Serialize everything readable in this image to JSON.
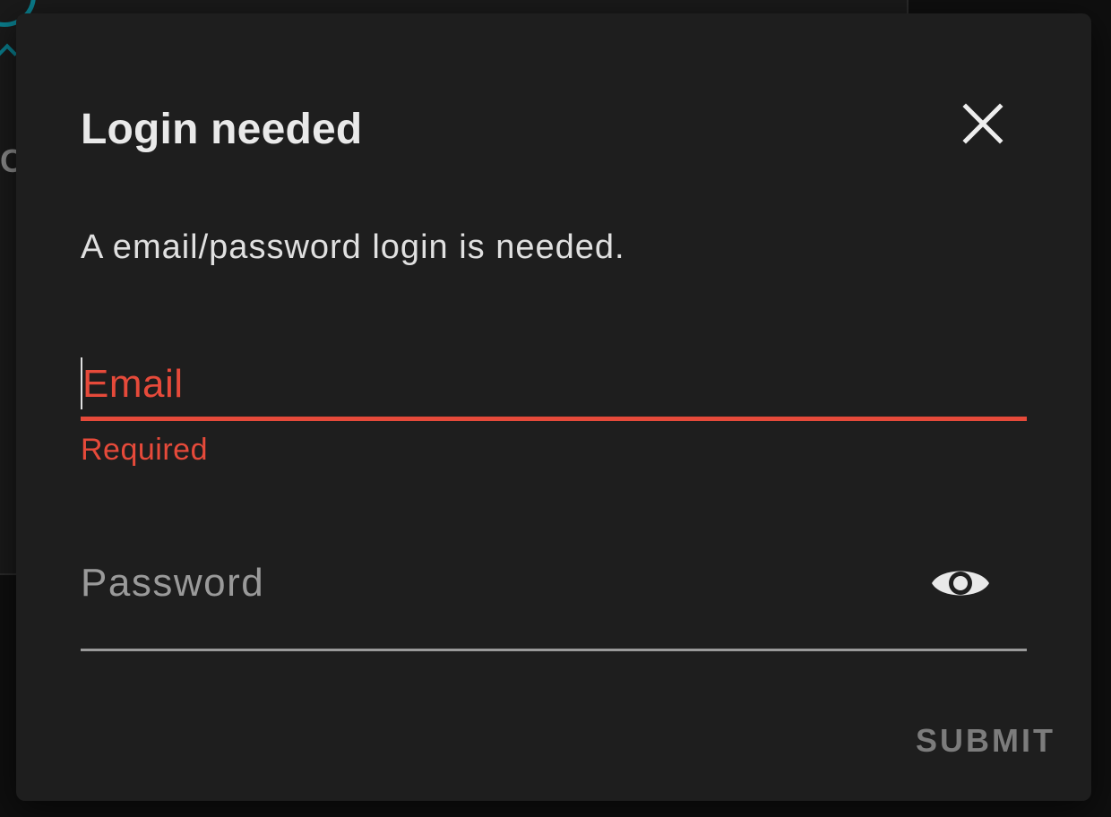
{
  "dialog": {
    "title": "Login needed",
    "description": "A email/password login is needed.",
    "close_icon": "close-icon"
  },
  "email_field": {
    "label": "Email",
    "value": "",
    "helper_text": "Required",
    "state": "error"
  },
  "password_field": {
    "label": "Password",
    "value": "",
    "toggle_icon": "eye-icon"
  },
  "actions": {
    "submit_label": "SUBMIT",
    "submit_enabled": false
  },
  "colors": {
    "surface": "#1e1e1e",
    "error": "#e64a3a",
    "text_primary": "#e9e9e9",
    "text_disabled": "#7c7c7c",
    "background_accent": "#0a7d8c"
  }
}
